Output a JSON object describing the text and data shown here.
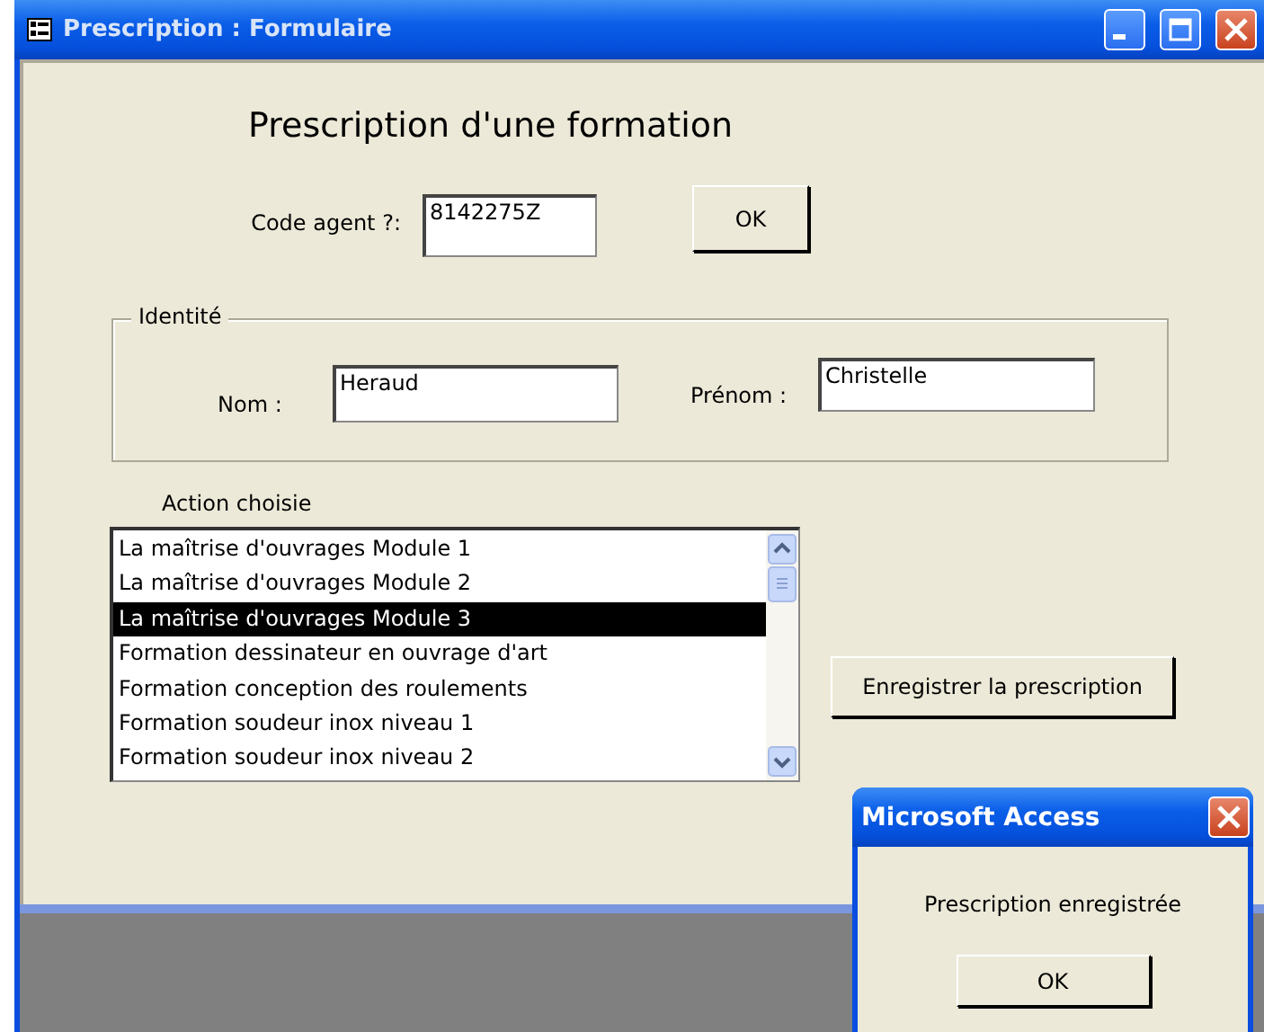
{
  "window": {
    "title": "Prescription : Formulaire"
  },
  "form": {
    "heading": "Prescription d'une formation",
    "code_agent": {
      "label": "Code agent ?:",
      "value": "8142275Z"
    },
    "ok_button": "OK",
    "identity": {
      "legend": "Identité",
      "fields": [
        {
          "label": "Nom :",
          "value": "Heraud"
        },
        {
          "label": "Prénom :",
          "value": "Christelle"
        }
      ]
    },
    "action": {
      "label": "Action choisie",
      "items": [
        {
          "text": "La maîtrise d'ouvrages Module 1",
          "selected": false
        },
        {
          "text": "La maîtrise d'ouvrages Module 2",
          "selected": false
        },
        {
          "text": "La maîtrise d'ouvrages Module 3",
          "selected": true
        },
        {
          "text": "Formation dessinateur en ouvrage d'art",
          "selected": false
        },
        {
          "text": "Formation conception des roulements",
          "selected": false
        },
        {
          "text": "Formation soudeur inox niveau 1",
          "selected": false
        },
        {
          "text": "Formation soudeur inox niveau 2",
          "selected": false
        }
      ]
    },
    "save_button": "Enregistrer la prescription"
  },
  "dialog": {
    "title": "Microsoft Access",
    "message": "Prescription enregistrée",
    "button": "OK"
  }
}
